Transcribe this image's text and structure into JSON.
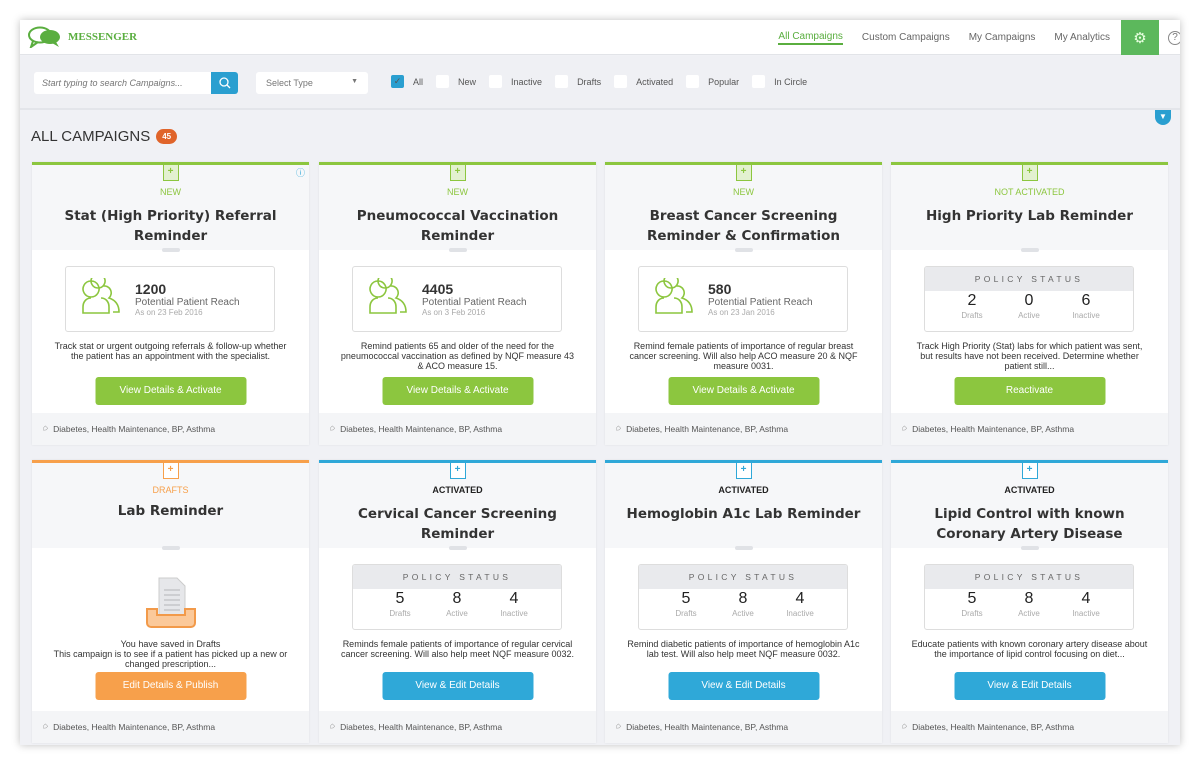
{
  "app": {
    "name": "MESSENGER"
  },
  "nav": [
    {
      "label": "All Campaigns",
      "active": true
    },
    {
      "label": "Custom Campaigns"
    },
    {
      "label": "My Campaigns"
    },
    {
      "label": "My Analytics"
    }
  ],
  "filters": {
    "search_placeholder": "Start typing to search Campaigns...",
    "select_type": "Select Type",
    "checkboxes": [
      {
        "label": "All",
        "checked": true
      },
      {
        "label": "New",
        "checked": false
      },
      {
        "label": "Inactive",
        "checked": false
      },
      {
        "label": "Drafts",
        "checked": false
      },
      {
        "label": "Activated",
        "checked": false
      },
      {
        "label": "Popular",
        "checked": false
      },
      {
        "label": "In Circle",
        "checked": false
      }
    ]
  },
  "page": {
    "title": "ALL CAMPAIGNS",
    "count": "45"
  },
  "colors": {
    "green": "#8cc63f",
    "orange": "#f7a04b",
    "blue": "#2fa8d8",
    "nav_green": "#5aae3f",
    "badge": "#e0642a"
  },
  "policy_header": "POLICY STATUS",
  "cards": [
    {
      "status": "NEW",
      "theme": "green",
      "title": "Stat (High Priority) Referral Reminder",
      "kind": "reach",
      "reach": "1200",
      "reach_label": "Potential Patient Reach",
      "date": "As on 23 Feb 2016",
      "desc": "Track stat or urgent outgoing referrals & follow-up whether the patient has an appointment with the specialist.",
      "button": "View Details & Activate",
      "tags": "Diabetes, Health Maintenance, BP, Asthma"
    },
    {
      "status": "NEW",
      "theme": "green",
      "title": "Pneumococcal Vaccination Reminder",
      "kind": "reach",
      "reach": "4405",
      "reach_label": "Potential Patient Reach",
      "date": "As on 3 Feb 2016",
      "desc": "Remind patients 65 and older of the need for the pneumococcal vaccination as defined by NQF measure 43 & ACO measure 15.",
      "button": "View Details & Activate",
      "tags": "Diabetes, Health Maintenance, BP, Asthma"
    },
    {
      "status": "NEW",
      "theme": "green",
      "title": "Breast Cancer Screening Reminder & Confirmation",
      "kind": "reach",
      "reach": "580",
      "reach_label": "Potential Patient Reach",
      "date": "As on 23 Jan 2016",
      "desc": "Remind female patients of importance of regular breast cancer screening. Will also help ACO measure 20 & NQF measure 0031.",
      "button": "View Details & Activate",
      "tags": "Diabetes, Health Maintenance, BP, Asthma"
    },
    {
      "status": "NOT ACTIVATED",
      "theme": "green",
      "title": "High Priority Lab Reminder",
      "kind": "policy",
      "drafts": "2",
      "active": "0",
      "inactive": "6",
      "labels": [
        "Drafts",
        "Active",
        "Inactive"
      ],
      "desc": "Track High Priority (Stat) labs for which patient was sent, but results have not been received. Determine whether patient still...",
      "button": "Reactivate",
      "tags": "Diabetes, Health Maintenance, BP, Asthma"
    },
    {
      "status": "DRAFTS",
      "theme": "orange",
      "title": "Lab Reminder",
      "kind": "draft",
      "desc": "You have saved in Drafts\nThis campaign is to see if a patient has picked up a new or changed prescription...",
      "button": "Edit Details & Publish",
      "tags": "Diabetes, Health Maintenance, BP, Asthma"
    },
    {
      "status": "ACTIVATED",
      "theme": "blue",
      "title": "Cervical Cancer Screening Reminder",
      "kind": "policy",
      "drafts": "5",
      "active": "8",
      "inactive": "4",
      "labels": [
        "Drafts",
        "Active",
        "Inactive"
      ],
      "desc": "Reminds female patients of importance of regular cervical cancer screening. Will also help meet NQF measure 0032.",
      "button": "View & Edit Details",
      "tags": "Diabetes, Health Maintenance, BP, Asthma"
    },
    {
      "status": "ACTIVATED",
      "theme": "blue",
      "title": "Hemoglobin A1c Lab Reminder",
      "kind": "policy",
      "drafts": "5",
      "active": "8",
      "inactive": "4",
      "labels": [
        "Drafts",
        "Active",
        "Inactive"
      ],
      "desc": "Remind diabetic patients of importance of hemoglobin A1c lab test. Will also help meet NQF measure 0032.",
      "button": "View & Edit Details",
      "tags": "Diabetes, Health Maintenance, BP, Asthma"
    },
    {
      "status": "ACTIVATED",
      "theme": "blue",
      "title": "Lipid Control with known Coronary Artery Disease",
      "kind": "policy",
      "drafts": "5",
      "active": "8",
      "inactive": "4",
      "labels": [
        "Drafts",
        "Active",
        "Inactive"
      ],
      "desc": "Educate patients with known coronary artery disease about the importance of lipid control focusing on diet...",
      "button": "View & Edit Details",
      "tags": "Diabetes, Health Maintenance, BP, Asthma"
    }
  ]
}
